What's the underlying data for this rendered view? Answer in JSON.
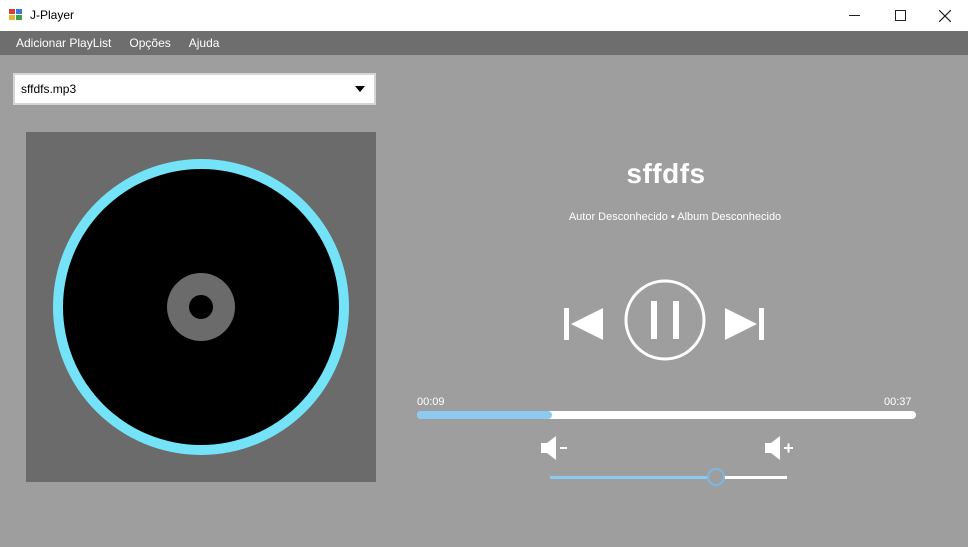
{
  "window": {
    "title": "J-Player"
  },
  "menu": {
    "items": [
      "Adicionar PlayList",
      "Opções",
      "Ajuda"
    ]
  },
  "playlist_select": {
    "selected": "sffdfs.mp3"
  },
  "track": {
    "title": "sffdfs",
    "meta": "Autor Desconhecido  •  Album Desconhecido",
    "elapsed": "00:09",
    "duration": "00:37",
    "progress": 0.27
  },
  "volume": {
    "level": 0.7
  },
  "colors": {
    "accent": "#8ec9f2",
    "disc_ring": "#74e3f7",
    "background": "#9e9e9e",
    "menubar": "#6e6e6e"
  },
  "icons": {
    "previous": "skip-previous-icon",
    "pause": "pause-circle-icon",
    "next": "skip-next-icon",
    "volume_down": "volume-down-icon",
    "volume_up": "volume-up-icon"
  }
}
